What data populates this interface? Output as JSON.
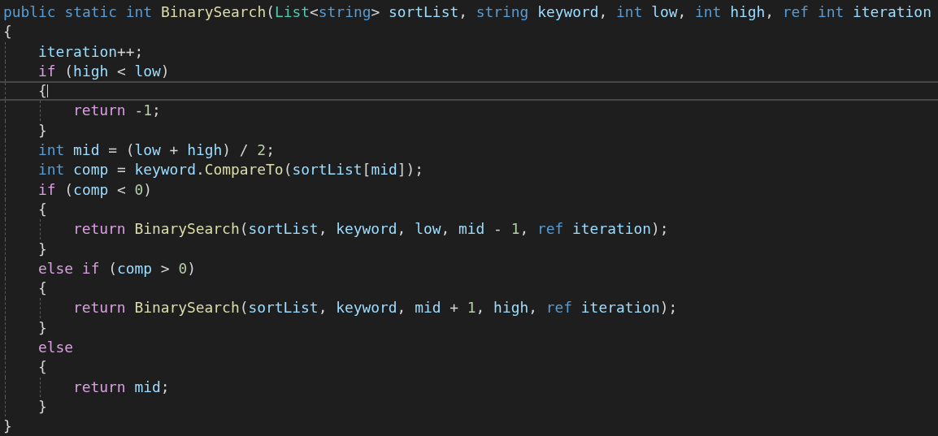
{
  "editor": {
    "lines": [
      {
        "tokens": [
          {
            "kind": "kw",
            "text": "public "
          },
          {
            "kind": "kw",
            "text": "static "
          },
          {
            "kind": "kw",
            "text": "int "
          },
          {
            "kind": "fn",
            "text": "BinarySearch"
          },
          {
            "kind": "p",
            "text": "("
          },
          {
            "kind": "type",
            "text": "List"
          },
          {
            "kind": "p",
            "text": "<"
          },
          {
            "kind": "kw",
            "text": "string"
          },
          {
            "kind": "p",
            "text": "> "
          },
          {
            "kind": "var",
            "text": "sortList"
          },
          {
            "kind": "p",
            "text": ", "
          },
          {
            "kind": "kw",
            "text": "string "
          },
          {
            "kind": "var",
            "text": "keyword"
          },
          {
            "kind": "p",
            "text": ", "
          },
          {
            "kind": "kw",
            "text": "int "
          },
          {
            "kind": "var",
            "text": "low"
          },
          {
            "kind": "p",
            "text": ", "
          },
          {
            "kind": "kw",
            "text": "int "
          },
          {
            "kind": "var",
            "text": "high"
          },
          {
            "kind": "p",
            "text": ", "
          },
          {
            "kind": "kw",
            "text": "ref int "
          },
          {
            "kind": "var",
            "text": "iteration"
          }
        ]
      },
      {
        "tokens": [
          {
            "kind": "p",
            "text": "{"
          }
        ]
      },
      {
        "children": [
          {
            "tokens": [
              {
                "kind": "var",
                "text": "iteration"
              },
              {
                "kind": "p",
                "text": "++;"
              }
            ]
          },
          {
            "tokens": [
              {
                "kind": "ctl",
                "text": "if "
              },
              {
                "kind": "p",
                "text": "("
              },
              {
                "kind": "var",
                "text": "high"
              },
              {
                "kind": "p",
                "text": " < "
              },
              {
                "kind": "var",
                "text": "low"
              },
              {
                "kind": "p",
                "text": ")"
              }
            ]
          },
          {
            "current": true,
            "tokens": [
              {
                "kind": "p",
                "text": "{"
              }
            ]
          },
          {
            "children": [
              {
                "tokens": [
                  {
                    "kind": "ctl",
                    "text": "return "
                  },
                  {
                    "kind": "p",
                    "text": "-"
                  },
                  {
                    "kind": "num",
                    "text": "1"
                  },
                  {
                    "kind": "p",
                    "text": ";"
                  }
                ]
              }
            ]
          },
          {
            "tokens": [
              {
                "kind": "p",
                "text": "}"
              }
            ]
          },
          {
            "tokens": [
              {
                "kind": "kw",
                "text": "int "
              },
              {
                "kind": "var",
                "text": "mid"
              },
              {
                "kind": "p",
                "text": " = ("
              },
              {
                "kind": "var",
                "text": "low"
              },
              {
                "kind": "p",
                "text": " + "
              },
              {
                "kind": "var",
                "text": "high"
              },
              {
                "kind": "p",
                "text": ") / "
              },
              {
                "kind": "num",
                "text": "2"
              },
              {
                "kind": "p",
                "text": ";"
              }
            ]
          },
          {
            "tokens": [
              {
                "kind": "kw",
                "text": "int "
              },
              {
                "kind": "var",
                "text": "comp"
              },
              {
                "kind": "p",
                "text": " = "
              },
              {
                "kind": "var",
                "text": "keyword"
              },
              {
                "kind": "p",
                "text": "."
              },
              {
                "kind": "fn",
                "text": "CompareTo"
              },
              {
                "kind": "p",
                "text": "("
              },
              {
                "kind": "var",
                "text": "sortList"
              },
              {
                "kind": "p",
                "text": "["
              },
              {
                "kind": "var",
                "text": "mid"
              },
              {
                "kind": "p",
                "text": "]);"
              }
            ]
          },
          {
            "tokens": [
              {
                "kind": "ctl",
                "text": "if "
              },
              {
                "kind": "p",
                "text": "("
              },
              {
                "kind": "var",
                "text": "comp"
              },
              {
                "kind": "p",
                "text": " < "
              },
              {
                "kind": "num",
                "text": "0"
              },
              {
                "kind": "p",
                "text": ")"
              }
            ]
          },
          {
            "tokens": [
              {
                "kind": "p",
                "text": "{"
              }
            ]
          },
          {
            "children": [
              {
                "tokens": [
                  {
                    "kind": "ctl",
                    "text": "return "
                  },
                  {
                    "kind": "fn",
                    "text": "BinarySearch"
                  },
                  {
                    "kind": "p",
                    "text": "("
                  },
                  {
                    "kind": "var",
                    "text": "sortList"
                  },
                  {
                    "kind": "p",
                    "text": ", "
                  },
                  {
                    "kind": "var",
                    "text": "keyword"
                  },
                  {
                    "kind": "p",
                    "text": ", "
                  },
                  {
                    "kind": "var",
                    "text": "low"
                  },
                  {
                    "kind": "p",
                    "text": ", "
                  },
                  {
                    "kind": "var",
                    "text": "mid"
                  },
                  {
                    "kind": "p",
                    "text": " - "
                  },
                  {
                    "kind": "num",
                    "text": "1"
                  },
                  {
                    "kind": "p",
                    "text": ", "
                  },
                  {
                    "kind": "kw",
                    "text": "ref "
                  },
                  {
                    "kind": "var",
                    "text": "iteration"
                  },
                  {
                    "kind": "p",
                    "text": ");"
                  }
                ]
              }
            ]
          },
          {
            "tokens": [
              {
                "kind": "p",
                "text": "}"
              }
            ]
          },
          {
            "tokens": [
              {
                "kind": "ctl",
                "text": "else if "
              },
              {
                "kind": "p",
                "text": "("
              },
              {
                "kind": "var",
                "text": "comp"
              },
              {
                "kind": "p",
                "text": " > "
              },
              {
                "kind": "num",
                "text": "0"
              },
              {
                "kind": "p",
                "text": ")"
              }
            ]
          },
          {
            "tokens": [
              {
                "kind": "p",
                "text": "{"
              }
            ]
          },
          {
            "children": [
              {
                "tokens": [
                  {
                    "kind": "ctl",
                    "text": "return "
                  },
                  {
                    "kind": "fn",
                    "text": "BinarySearch"
                  },
                  {
                    "kind": "p",
                    "text": "("
                  },
                  {
                    "kind": "var",
                    "text": "sortList"
                  },
                  {
                    "kind": "p",
                    "text": ", "
                  },
                  {
                    "kind": "var",
                    "text": "keyword"
                  },
                  {
                    "kind": "p",
                    "text": ", "
                  },
                  {
                    "kind": "var",
                    "text": "mid"
                  },
                  {
                    "kind": "p",
                    "text": " + "
                  },
                  {
                    "kind": "num",
                    "text": "1"
                  },
                  {
                    "kind": "p",
                    "text": ", "
                  },
                  {
                    "kind": "var",
                    "text": "high"
                  },
                  {
                    "kind": "p",
                    "text": ", "
                  },
                  {
                    "kind": "kw",
                    "text": "ref "
                  },
                  {
                    "kind": "var",
                    "text": "iteration"
                  },
                  {
                    "kind": "p",
                    "text": ");"
                  }
                ]
              }
            ]
          },
          {
            "tokens": [
              {
                "kind": "p",
                "text": "}"
              }
            ]
          },
          {
            "tokens": [
              {
                "kind": "ctl",
                "text": "else"
              }
            ]
          },
          {
            "tokens": [
              {
                "kind": "p",
                "text": "{"
              }
            ]
          },
          {
            "children": [
              {
                "tokens": [
                  {
                    "kind": "ctl",
                    "text": "return "
                  },
                  {
                    "kind": "var",
                    "text": "mid"
                  },
                  {
                    "kind": "p",
                    "text": ";"
                  }
                ]
              }
            ]
          },
          {
            "tokens": [
              {
                "kind": "p",
                "text": "}"
              }
            ]
          }
        ]
      },
      {
        "tokens": [
          {
            "kind": "p",
            "text": "}"
          }
        ]
      }
    ]
  }
}
